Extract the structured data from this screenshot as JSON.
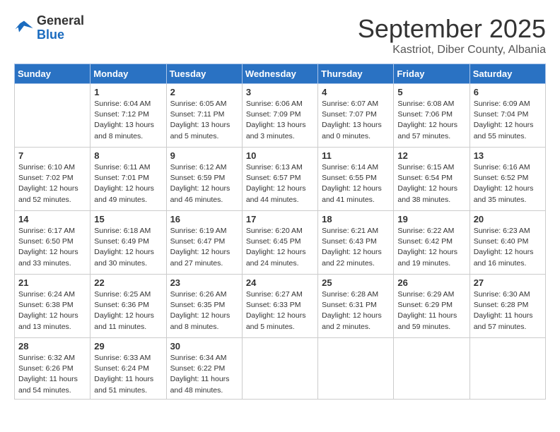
{
  "logo": {
    "general": "General",
    "blue": "Blue"
  },
  "header": {
    "month": "September 2025",
    "subtitle": "Kastriot, Diber County, Albania"
  },
  "days_of_week": [
    "Sunday",
    "Monday",
    "Tuesday",
    "Wednesday",
    "Thursday",
    "Friday",
    "Saturday"
  ],
  "weeks": [
    [
      {
        "day": "",
        "info": ""
      },
      {
        "day": "1",
        "info": "Sunrise: 6:04 AM\nSunset: 7:12 PM\nDaylight: 13 hours\nand 8 minutes."
      },
      {
        "day": "2",
        "info": "Sunrise: 6:05 AM\nSunset: 7:11 PM\nDaylight: 13 hours\nand 5 minutes."
      },
      {
        "day": "3",
        "info": "Sunrise: 6:06 AM\nSunset: 7:09 PM\nDaylight: 13 hours\nand 3 minutes."
      },
      {
        "day": "4",
        "info": "Sunrise: 6:07 AM\nSunset: 7:07 PM\nDaylight: 13 hours\nand 0 minutes."
      },
      {
        "day": "5",
        "info": "Sunrise: 6:08 AM\nSunset: 7:06 PM\nDaylight: 12 hours\nand 57 minutes."
      },
      {
        "day": "6",
        "info": "Sunrise: 6:09 AM\nSunset: 7:04 PM\nDaylight: 12 hours\nand 55 minutes."
      }
    ],
    [
      {
        "day": "7",
        "info": "Sunrise: 6:10 AM\nSunset: 7:02 PM\nDaylight: 12 hours\nand 52 minutes."
      },
      {
        "day": "8",
        "info": "Sunrise: 6:11 AM\nSunset: 7:01 PM\nDaylight: 12 hours\nand 49 minutes."
      },
      {
        "day": "9",
        "info": "Sunrise: 6:12 AM\nSunset: 6:59 PM\nDaylight: 12 hours\nand 46 minutes."
      },
      {
        "day": "10",
        "info": "Sunrise: 6:13 AM\nSunset: 6:57 PM\nDaylight: 12 hours\nand 44 minutes."
      },
      {
        "day": "11",
        "info": "Sunrise: 6:14 AM\nSunset: 6:55 PM\nDaylight: 12 hours\nand 41 minutes."
      },
      {
        "day": "12",
        "info": "Sunrise: 6:15 AM\nSunset: 6:54 PM\nDaylight: 12 hours\nand 38 minutes."
      },
      {
        "day": "13",
        "info": "Sunrise: 6:16 AM\nSunset: 6:52 PM\nDaylight: 12 hours\nand 35 minutes."
      }
    ],
    [
      {
        "day": "14",
        "info": "Sunrise: 6:17 AM\nSunset: 6:50 PM\nDaylight: 12 hours\nand 33 minutes."
      },
      {
        "day": "15",
        "info": "Sunrise: 6:18 AM\nSunset: 6:49 PM\nDaylight: 12 hours\nand 30 minutes."
      },
      {
        "day": "16",
        "info": "Sunrise: 6:19 AM\nSunset: 6:47 PM\nDaylight: 12 hours\nand 27 minutes."
      },
      {
        "day": "17",
        "info": "Sunrise: 6:20 AM\nSunset: 6:45 PM\nDaylight: 12 hours\nand 24 minutes."
      },
      {
        "day": "18",
        "info": "Sunrise: 6:21 AM\nSunset: 6:43 PM\nDaylight: 12 hours\nand 22 minutes."
      },
      {
        "day": "19",
        "info": "Sunrise: 6:22 AM\nSunset: 6:42 PM\nDaylight: 12 hours\nand 19 minutes."
      },
      {
        "day": "20",
        "info": "Sunrise: 6:23 AM\nSunset: 6:40 PM\nDaylight: 12 hours\nand 16 minutes."
      }
    ],
    [
      {
        "day": "21",
        "info": "Sunrise: 6:24 AM\nSunset: 6:38 PM\nDaylight: 12 hours\nand 13 minutes."
      },
      {
        "day": "22",
        "info": "Sunrise: 6:25 AM\nSunset: 6:36 PM\nDaylight: 12 hours\nand 11 minutes."
      },
      {
        "day": "23",
        "info": "Sunrise: 6:26 AM\nSunset: 6:35 PM\nDaylight: 12 hours\nand 8 minutes."
      },
      {
        "day": "24",
        "info": "Sunrise: 6:27 AM\nSunset: 6:33 PM\nDaylight: 12 hours\nand 5 minutes."
      },
      {
        "day": "25",
        "info": "Sunrise: 6:28 AM\nSunset: 6:31 PM\nDaylight: 12 hours\nand 2 minutes."
      },
      {
        "day": "26",
        "info": "Sunrise: 6:29 AM\nSunset: 6:29 PM\nDaylight: 11 hours\nand 59 minutes."
      },
      {
        "day": "27",
        "info": "Sunrise: 6:30 AM\nSunset: 6:28 PM\nDaylight: 11 hours\nand 57 minutes."
      }
    ],
    [
      {
        "day": "28",
        "info": "Sunrise: 6:32 AM\nSunset: 6:26 PM\nDaylight: 11 hours\nand 54 minutes."
      },
      {
        "day": "29",
        "info": "Sunrise: 6:33 AM\nSunset: 6:24 PM\nDaylight: 11 hours\nand 51 minutes."
      },
      {
        "day": "30",
        "info": "Sunrise: 6:34 AM\nSunset: 6:22 PM\nDaylight: 11 hours\nand 48 minutes."
      },
      {
        "day": "",
        "info": ""
      },
      {
        "day": "",
        "info": ""
      },
      {
        "day": "",
        "info": ""
      },
      {
        "day": "",
        "info": ""
      }
    ]
  ]
}
